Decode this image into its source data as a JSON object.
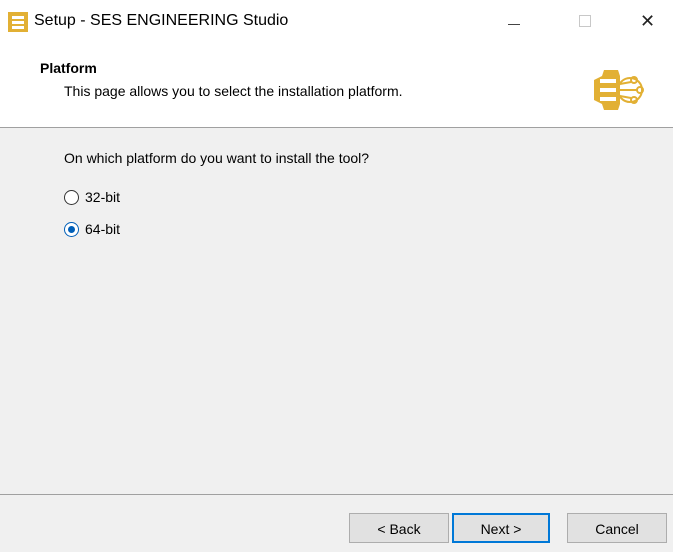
{
  "window": {
    "title": "Setup - SES ENGINEERING Studio",
    "close_glyph": "✕"
  },
  "header": {
    "title": "Platform",
    "subtitle": "This page allows you to select the installation platform."
  },
  "body": {
    "question": "On which platform do you want to install the tool?",
    "options": [
      {
        "label": "32-bit",
        "selected": false
      },
      {
        "label": "64-bit",
        "selected": true
      }
    ]
  },
  "footer": {
    "back_label": "< Back",
    "next_label": "Next >",
    "cancel_label": "Cancel"
  },
  "colors": {
    "accent": "#0078d7",
    "brand": "#e2b034"
  },
  "icons": {
    "app": "app-logo-icon",
    "header": "ses-logo-icon"
  }
}
